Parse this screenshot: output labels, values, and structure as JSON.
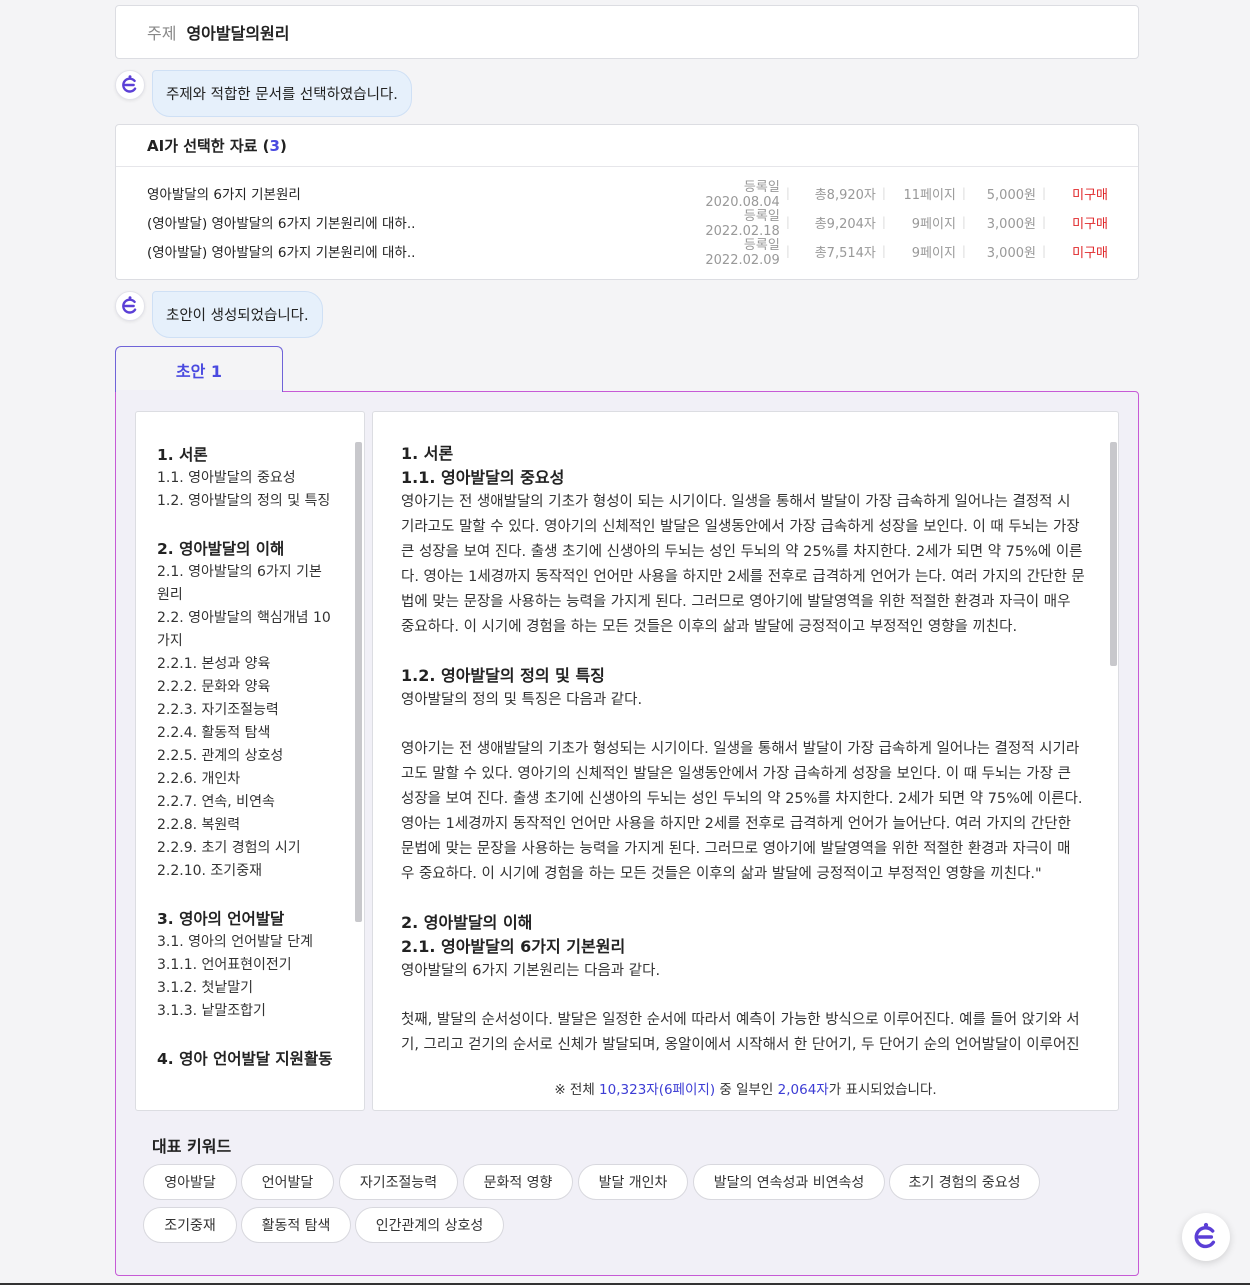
{
  "topic": {
    "label": "주제",
    "value": "영아발달의원리"
  },
  "messages": {
    "select_docs": "주제와 적합한 문서를 선택하였습니다.",
    "draft_created": "초안이 생성되었습니다."
  },
  "docs": {
    "head_prefix": "AI가 선택한 자료 (",
    "head_count": "3",
    "head_suffix": ")",
    "rows": [
      {
        "title": "영아발달의 6가지 기본원리",
        "date": "등록일 2020.08.04",
        "chars": "총8,920자",
        "pages": "11페이지",
        "price": "5,000원",
        "status": "미구매"
      },
      {
        "title": "(영아발달) 영아발달의 6가지 기본원리에 대하..",
        "date": "등록일 2022.02.18",
        "chars": "총9,204자",
        "pages": "9페이지",
        "price": "3,000원",
        "status": "미구매"
      },
      {
        "title": "(영아발달) 영아발달의 6가지 기본원리에 대하..",
        "date": "등록일 2022.02.09",
        "chars": "총7,514자",
        "pages": "9페이지",
        "price": "3,000원",
        "status": "미구매"
      }
    ]
  },
  "tab": {
    "label": "초안 1"
  },
  "toc": [
    {
      "type": "h",
      "text": "1. 서론"
    },
    {
      "type": "i",
      "text": "1.1. 영아발달의 중요성"
    },
    {
      "type": "i",
      "text": "1.2. 영아발달의 정의 및 특징"
    },
    {
      "type": "gap"
    },
    {
      "type": "h",
      "text": "2. 영아발달의 이해"
    },
    {
      "type": "i",
      "text": "2.1. 영아발달의 6가지 기본"
    },
    {
      "type": "i",
      "text": "원리"
    },
    {
      "type": "i",
      "text": "2.2. 영아발달의 핵심개념 10"
    },
    {
      "type": "i",
      "text": "가지"
    },
    {
      "type": "i",
      "text": "2.2.1. 본성과 양육"
    },
    {
      "type": "i",
      "text": "2.2.2. 문화와 양육"
    },
    {
      "type": "i",
      "text": "2.2.3. 자기조절능력"
    },
    {
      "type": "i",
      "text": "2.2.4. 활동적 탐색"
    },
    {
      "type": "i",
      "text": "2.2.5. 관계의 상호성"
    },
    {
      "type": "i",
      "text": "2.2.6. 개인차"
    },
    {
      "type": "i",
      "text": "2.2.7. 연속, 비연속"
    },
    {
      "type": "i",
      "text": "2.2.8. 복원력"
    },
    {
      "type": "i",
      "text": "2.2.9. 초기 경험의 시기"
    },
    {
      "type": "i",
      "text": "2.2.10. 조기중재"
    },
    {
      "type": "gap"
    },
    {
      "type": "h",
      "text": "3. 영아의 언어발달"
    },
    {
      "type": "i",
      "text": "3.1. 영아의 언어발달 단계"
    },
    {
      "type": "i",
      "text": "3.1.1. 언어표현이전기"
    },
    {
      "type": "i",
      "text": "3.1.2. 첫낱말기"
    },
    {
      "type": "i",
      "text": "3.1.3. 낱말조합기"
    },
    {
      "type": "gap"
    },
    {
      "type": "h",
      "text": "4. 영아 언어발달 지원활동"
    }
  ],
  "content": [
    {
      "type": "h",
      "text": "1. 서론"
    },
    {
      "type": "h",
      "text": "1.1. 영아발달의 중요성"
    },
    {
      "type": "p",
      "text": "영아기는 전 생애발달의 기초가 형성이 되는 시기이다. 일생을 통해서 발달이 가장 급속하게 일어나는 결정적 시"
    },
    {
      "type": "p",
      "text": "기라고도 말할 수 있다. 영아기의 신체적인 발달은 일생동안에서 가장 급속하게 성장을 보인다. 이 때 두뇌는 가장"
    },
    {
      "type": "p",
      "text": "큰 성장을 보여 진다. 출생 초기에 신생아의 두뇌는 성인 두뇌의 약 25%를 차지한다. 2세가 되면 약 75%에 이른"
    },
    {
      "type": "p",
      "text": "다. 영아는 1세경까지 동작적인 언어만 사용을 하지만 2세를 전후로 급격하게 언어가 는다. 여러 가지의 간단한 문"
    },
    {
      "type": "p",
      "text": "법에 맞는 문장을 사용하는 능력을 가지게 된다. 그러므로 영아기에 발달영역을 위한 적절한 환경과 자극이 매우"
    },
    {
      "type": "p",
      "text": "중요하다. 이 시기에 경험을 하는 모든 것들은 이후의 삶과 발달에 긍정적이고 부정적인 영향을 끼친다."
    },
    {
      "type": "gap"
    },
    {
      "type": "h",
      "text": "1.2. 영아발달의 정의 및 특징"
    },
    {
      "type": "p",
      "text": "영아발달의 정의 및 특징은 다음과 같다."
    },
    {
      "type": "gap"
    },
    {
      "type": "p",
      "text": "영아기는 전 생애발달의 기초가 형성되는 시기이다. 일생을 통해서 발달이 가장 급속하게 일어나는 결정적 시기라"
    },
    {
      "type": "p",
      "text": "고도 말할 수 있다. 영아기의 신체적인 발달은 일생동안에서 가장 급속하게 성장을 보인다. 이 때 두뇌는 가장 큰"
    },
    {
      "type": "p",
      "text": "성장을 보여 진다. 출생 초기에 신생아의 두뇌는 성인 두뇌의 약 25%를 차지한다. 2세가 되면 약 75%에 이른다."
    },
    {
      "type": "p",
      "text": "영아는 1세경까지 동작적인 언어만 사용을 하지만 2세를 전후로 급격하게 언어가 늘어난다. 여러 가지의 간단한"
    },
    {
      "type": "p",
      "text": "문법에 맞는 문장을 사용하는 능력을 가지게 된다. 그러므로 영아기에 발달영역을 위한 적절한 환경과 자극이 매"
    },
    {
      "type": "p",
      "text": "우 중요하다. 이 시기에 경험을 하는 모든 것들은 이후의 삶과 발달에 긍정적이고 부정적인 영향을 끼친다.\""
    },
    {
      "type": "gap"
    },
    {
      "type": "h",
      "text": "2. 영아발달의 이해"
    },
    {
      "type": "h",
      "text": "2.1. 영아발달의 6가지 기본원리"
    },
    {
      "type": "p",
      "text": "영아발달의 6가지 기본원리는 다음과 같다."
    },
    {
      "type": "gap"
    },
    {
      "type": "p",
      "text": "첫째, 발달의 순서성이다. 발달은 일정한 순서에 따라서 예측이 가능한 방식으로 이루어진다. 예를 들어 앉기와 서"
    },
    {
      "type": "p",
      "text": "기, 그리고 걷기의 순서로 신체가 발달되며, 옹알이에서 시작해서 한 단어기, 두 단어기 순의 언어발달이 이루어진"
    }
  ],
  "note": {
    "prefix": "※ 전체 ",
    "total": "10,323자(6페이지)",
    "middle": " 중 일부인 ",
    "shown": "2,064자",
    "suffix": "가 표시되었습니다."
  },
  "keywords": {
    "title": "대표 키워드",
    "items": [
      "영아발달",
      "언어발달",
      "자기조절능력",
      "문화적 영향",
      "발달 개인차",
      "발달의 연속성과 비연속성",
      "초기 경험의 중요성",
      "조기중재",
      "활동적 탐색",
      "인간관계의 상호성"
    ]
  },
  "icons": {
    "bot": "bot-e-icon"
  },
  "colors": {
    "accent": "#4a4ae0",
    "status": "#e0282b",
    "bubble": "#e6f0fb",
    "panel_border": "#c65ad6"
  }
}
